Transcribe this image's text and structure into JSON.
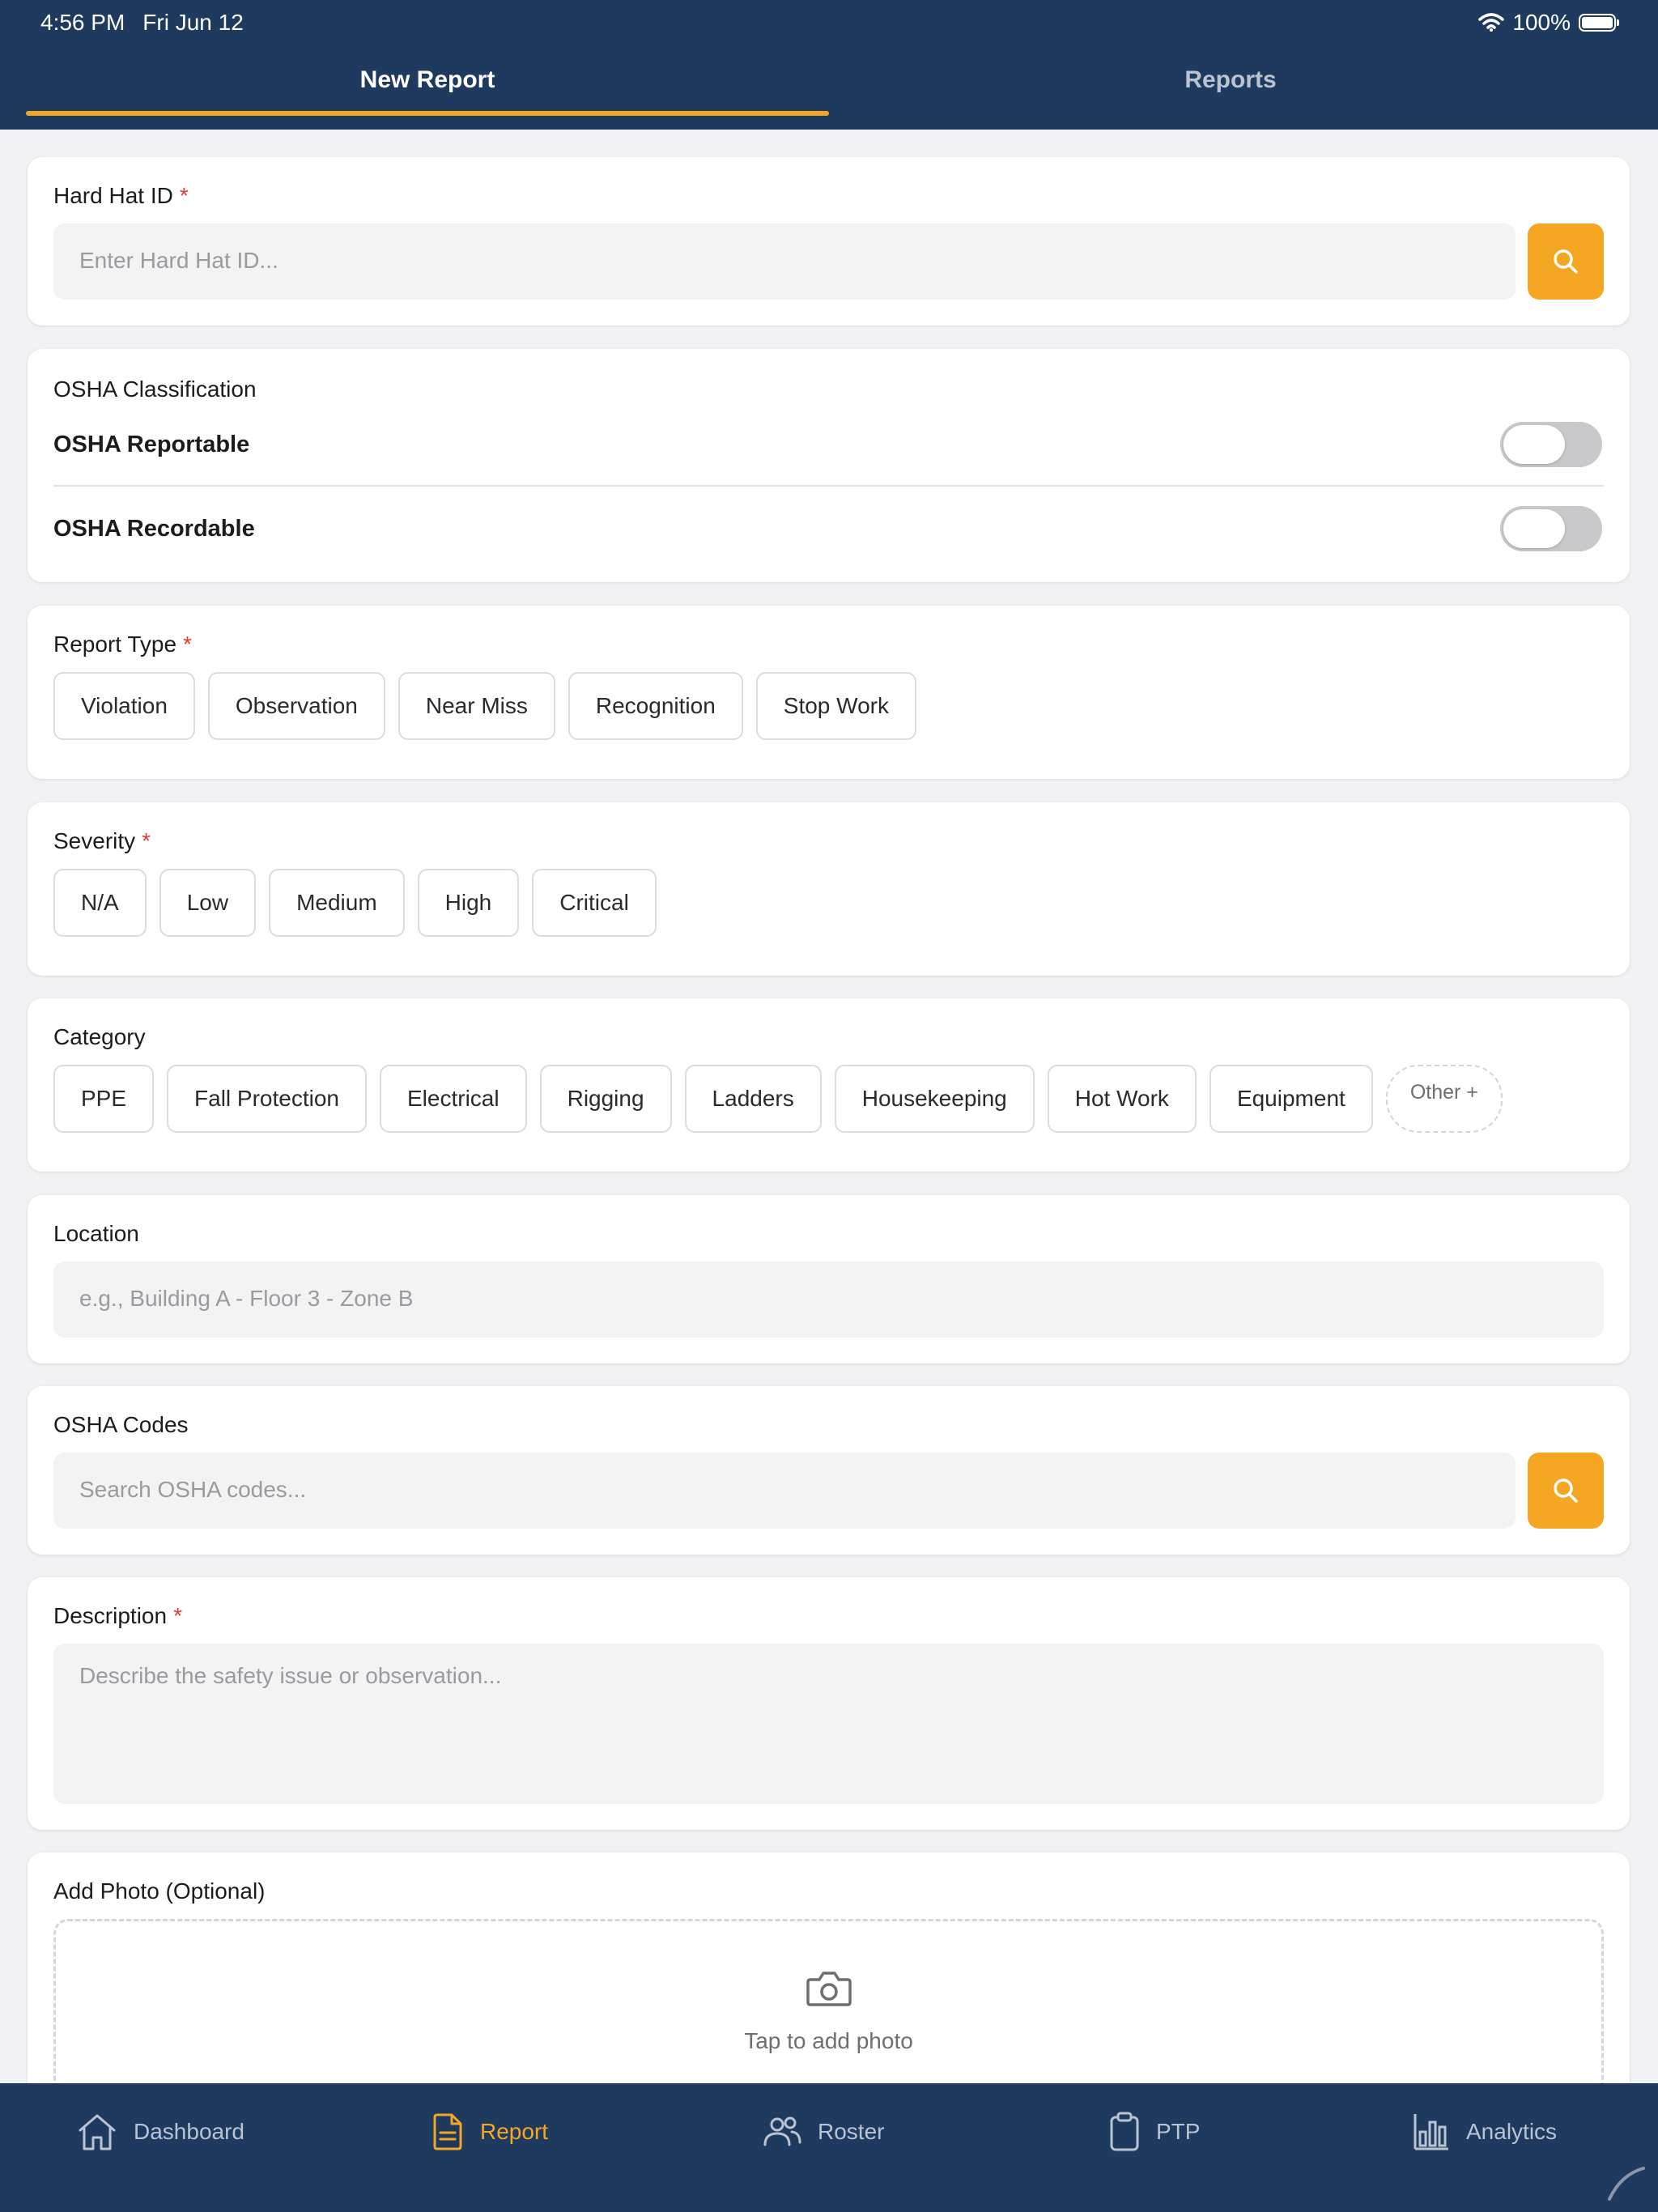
{
  "status_bar": {
    "time": "4:56 PM",
    "date": "Fri Jun 12",
    "battery": "100%"
  },
  "tabs": [
    {
      "label": "New Report",
      "active": true
    },
    {
      "label": "Reports",
      "active": false
    }
  ],
  "hard_hat": {
    "label": "Hard Hat ID",
    "required_mark": "*",
    "placeholder": "Enter Hard Hat ID..."
  },
  "osha_classification": {
    "title": "OSHA Classification",
    "reportable_label": "OSHA Reportable",
    "recordable_label": "OSHA Recordable",
    "reportable_on": false,
    "recordable_on": false
  },
  "report_type": {
    "label": "Report Type",
    "required_mark": "*",
    "options": [
      "Violation",
      "Observation",
      "Near Miss",
      "Recognition",
      "Stop Work"
    ]
  },
  "severity": {
    "label": "Severity",
    "required_mark": "*",
    "options": [
      "N/A",
      "Low",
      "Medium",
      "High",
      "Critical"
    ]
  },
  "category": {
    "label": "Category",
    "options": [
      "PPE",
      "Fall Protection",
      "Electrical",
      "Rigging",
      "Ladders",
      "Housekeeping",
      "Hot Work",
      "Equipment"
    ],
    "other_label": "Other +"
  },
  "location": {
    "label": "Location",
    "placeholder": "e.g., Building A - Floor 3 - Zone B"
  },
  "osha_codes": {
    "label": "OSHA Codes",
    "placeholder": "Search OSHA codes..."
  },
  "description": {
    "label": "Description",
    "required_mark": "*",
    "placeholder": "Describe the safety issue or observation..."
  },
  "photo": {
    "label": "Add Photo (Optional)",
    "hint": "Tap to add photo",
    "icon": "camera-icon"
  },
  "bottom_nav": [
    {
      "label": "Dashboard",
      "icon": "home-icon",
      "active": false
    },
    {
      "label": "Report",
      "icon": "document-icon",
      "active": true
    },
    {
      "label": "Roster",
      "icon": "people-icon",
      "active": false
    },
    {
      "label": "PTP",
      "icon": "clipboard-icon",
      "active": false
    },
    {
      "label": "Analytics",
      "icon": "bar-chart-icon",
      "active": false
    }
  ],
  "colors": {
    "navy": "#1f3a5f",
    "accent": "#f5a623",
    "required": "#e53935",
    "background": "#f2f2f4"
  }
}
